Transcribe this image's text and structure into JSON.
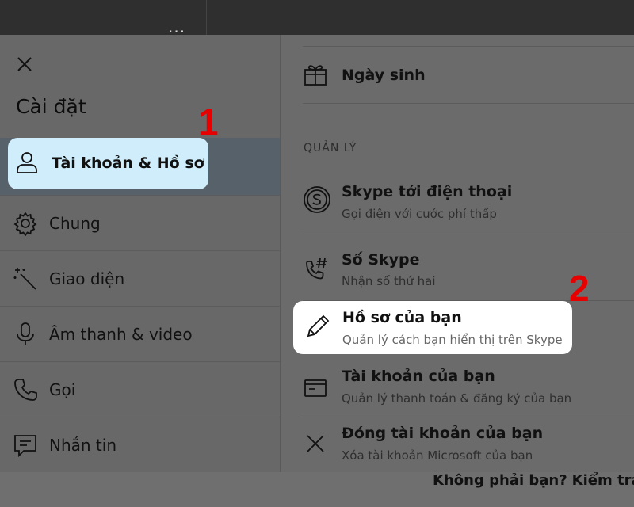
{
  "background": {
    "more_dots": "...",
    "not_you_text": "Không phải bạn?",
    "check_link": "Kiểm tra"
  },
  "dialog": {
    "title": "Cài đặt",
    "nav": [
      {
        "label": "Tài khoản & Hồ sơ",
        "icon": "person-icon",
        "active": true
      },
      {
        "label": "Chung",
        "icon": "gear-icon"
      },
      {
        "label": "Giao diện",
        "icon": "magic-wand-icon"
      },
      {
        "label": "Âm thanh & video",
        "icon": "microphone-icon"
      },
      {
        "label": "Gọi",
        "icon": "phone-icon"
      },
      {
        "label": "Nhắn tin",
        "icon": "chat-icon"
      }
    ],
    "right": {
      "birthday": {
        "title": "Ngày sinh",
        "icon": "gift-icon"
      },
      "section_label": "QUẢN LÝ",
      "items": [
        {
          "title": "Skype tới điện thoại",
          "subtitle": "Gọi điện với cước phí thấp",
          "icon": "skype-icon"
        },
        {
          "title": "Số Skype",
          "subtitle": "Nhận số thứ hai",
          "icon": "phone-hash-icon"
        },
        {
          "title": "Hồ sơ của bạn",
          "subtitle": "Quản lý cách bạn hiển thị trên Skype",
          "icon": "pencil-icon",
          "highlighted": true
        },
        {
          "title": "Tài khoản của bạn",
          "subtitle": "Quản lý thanh toán & đăng ký của bạn",
          "icon": "card-icon"
        },
        {
          "title": "Đóng tài khoản của bạn",
          "subtitle": "Xóa tài khoản Microsoft của bạn",
          "icon": "close-icon"
        }
      ]
    }
  },
  "annotations": {
    "step1": "1",
    "step2": "2"
  },
  "colors": {
    "highlight_blue": "#cfedfa",
    "annotation_red": "#e60000",
    "overlay": "#6b6b6b"
  }
}
